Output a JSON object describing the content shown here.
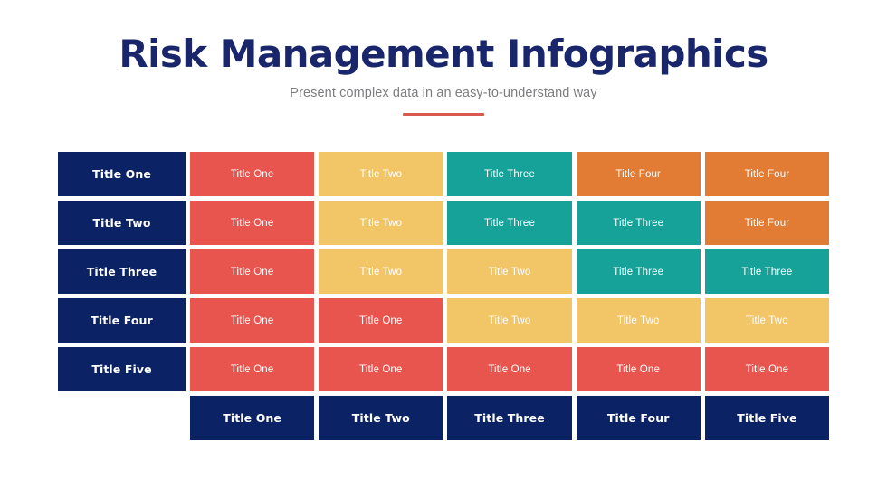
{
  "header": {
    "title": "Risk Management Infographics",
    "subtitle": "Present complex data in an easy-to-understand way",
    "divider_color": "#d9584f"
  },
  "palette": {
    "navy": "#0b2265",
    "red": "#e8554f",
    "yellow": "#f2c566",
    "teal": "#16a199",
    "orange": "#e27b33",
    "title_color": "#19266b",
    "subtitle_color": "#7d7d80",
    "cell_text_color": "#ffffff",
    "background": "#ffffff"
  },
  "matrix": {
    "row_headers": [
      "Title One",
      "Title Two",
      "Title Three",
      "Title Four",
      "Title Five"
    ],
    "column_headers": [
      "Title One",
      "Title Two",
      "Title Three",
      "Title Four",
      "Title Five"
    ],
    "rows": [
      {
        "header": "Title One",
        "cells": [
          {
            "label": "Title One",
            "level": "red"
          },
          {
            "label": "Title Two",
            "level": "yellow"
          },
          {
            "label": "Title Three",
            "level": "teal"
          },
          {
            "label": "Title Four",
            "level": "orange"
          },
          {
            "label": "Title Four",
            "level": "orange"
          }
        ]
      },
      {
        "header": "Title Two",
        "cells": [
          {
            "label": "Title One",
            "level": "red"
          },
          {
            "label": "Title Two",
            "level": "yellow"
          },
          {
            "label": "Title Three",
            "level": "teal"
          },
          {
            "label": "Title Three",
            "level": "teal"
          },
          {
            "label": "Title Four",
            "level": "orange"
          }
        ]
      },
      {
        "header": "Title Three",
        "cells": [
          {
            "label": "Title One",
            "level": "red"
          },
          {
            "label": "Title Two",
            "level": "yellow"
          },
          {
            "label": "Title Two",
            "level": "yellow"
          },
          {
            "label": "Title Three",
            "level": "teal"
          },
          {
            "label": "Title Three",
            "level": "teal"
          }
        ]
      },
      {
        "header": "Title Four",
        "cells": [
          {
            "label": "Title One",
            "level": "red"
          },
          {
            "label": "Title One",
            "level": "red"
          },
          {
            "label": "Title Two",
            "level": "yellow"
          },
          {
            "label": "Title Two",
            "level": "yellow"
          },
          {
            "label": "Title Two",
            "level": "yellow"
          }
        ]
      },
      {
        "header": "Title Five",
        "cells": [
          {
            "label": "Title One",
            "level": "red"
          },
          {
            "label": "Title One",
            "level": "red"
          },
          {
            "label": "Title One",
            "level": "red"
          },
          {
            "label": "Title One",
            "level": "red"
          },
          {
            "label": "Title One",
            "level": "red"
          }
        ]
      }
    ],
    "footer_row": {
      "first_cell_empty": true,
      "cells": [
        {
          "label": "Title One",
          "level": "navy"
        },
        {
          "label": "Title Two",
          "level": "navy"
        },
        {
          "label": "Title Three",
          "level": "navy"
        },
        {
          "label": "Title Four",
          "level": "navy"
        },
        {
          "label": "Title Five",
          "level": "navy"
        }
      ]
    }
  }
}
